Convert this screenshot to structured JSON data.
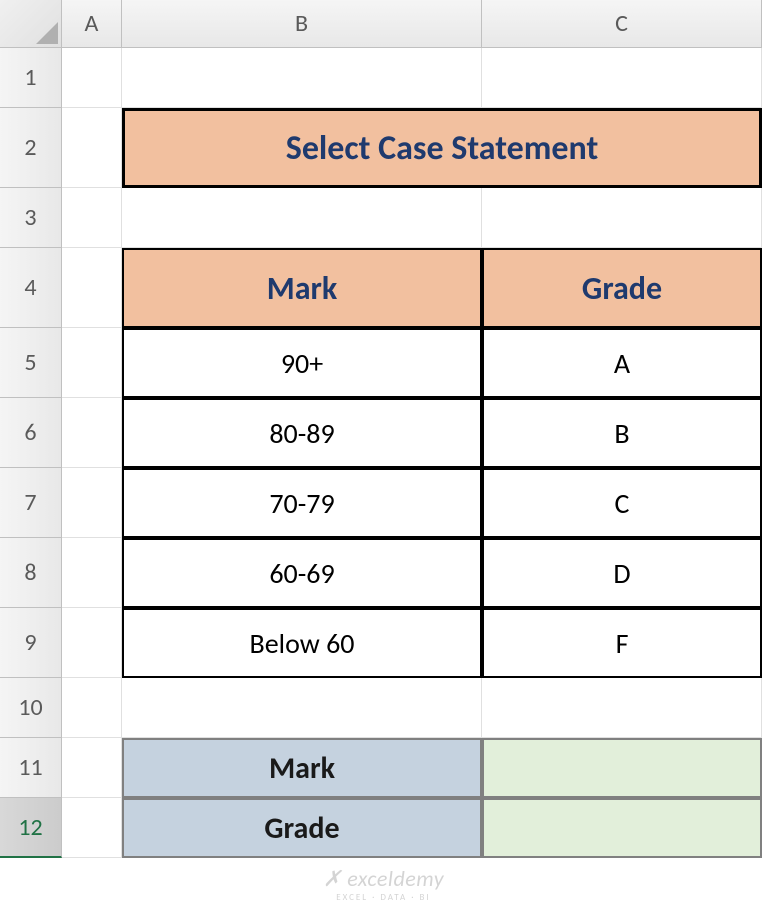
{
  "columns": [
    "A",
    "B",
    "C"
  ],
  "rows": [
    "1",
    "2",
    "3",
    "4",
    "5",
    "6",
    "7",
    "8",
    "9",
    "10",
    "11",
    "12"
  ],
  "selected_row": "12",
  "title": "Select Case Statement",
  "table": {
    "headers": {
      "mark": "Mark",
      "grade": "Grade"
    },
    "data": [
      {
        "mark": "90+",
        "grade": "A"
      },
      {
        "mark": "80-89",
        "grade": "B"
      },
      {
        "mark": "70-79",
        "grade": "C"
      },
      {
        "mark": "60-69",
        "grade": "D"
      },
      {
        "mark": "Below 60",
        "grade": "F"
      }
    ]
  },
  "input_area": {
    "mark_label": "Mark",
    "mark_value": "",
    "grade_label": "Grade",
    "grade_value": ""
  },
  "watermark": {
    "main": "✗ exceldemy",
    "sub": "EXCEL · DATA · BI"
  },
  "chart_data": {
    "type": "table",
    "title": "Select Case Statement",
    "columns": [
      "Mark",
      "Grade"
    ],
    "rows": [
      [
        "90+",
        "A"
      ],
      [
        "80-89",
        "B"
      ],
      [
        "70-79",
        "C"
      ],
      [
        "60-69",
        "D"
      ],
      [
        "Below 60",
        "F"
      ]
    ]
  }
}
